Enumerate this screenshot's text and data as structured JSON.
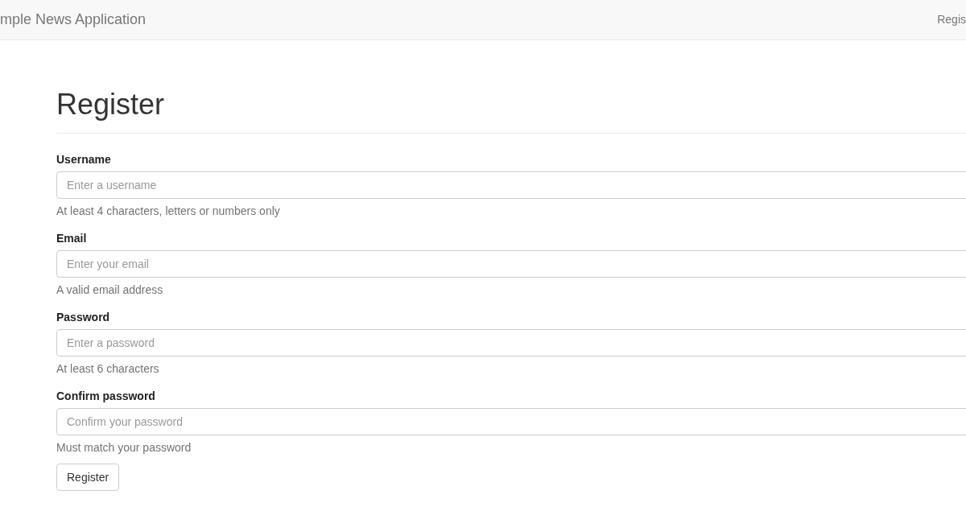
{
  "navbar": {
    "brand": "mple News Application",
    "link": "Regis"
  },
  "heading": "Register",
  "fields": [
    {
      "label": "Username",
      "placeholder": "Enter a username",
      "help": "At least 4 characters, letters or numbers only"
    },
    {
      "label": "Email",
      "placeholder": "Enter your email",
      "help": "A valid email address"
    },
    {
      "label": "Password",
      "placeholder": "Enter a password",
      "help": "At least 6 characters"
    },
    {
      "label": "Confirm password",
      "placeholder": "Confirm your password",
      "help": "Must match your password"
    }
  ],
  "submit": "Register"
}
